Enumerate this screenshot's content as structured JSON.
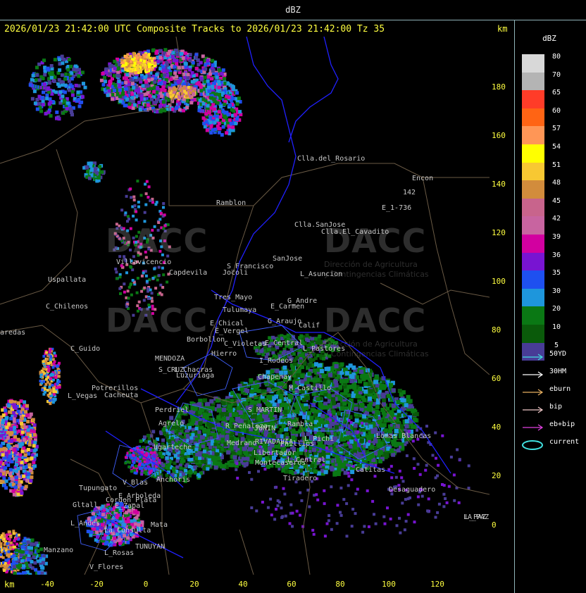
{
  "window": {
    "title": "dBZ"
  },
  "header": {
    "text": "2026/01/23 21:42:00 UTC Composite Tracks to 2026/01/23 21:42:00 Tz 35",
    "km_top": "km",
    "km_bottom": "km"
  },
  "axes": {
    "x_ticks": [
      "-40",
      "-20",
      "0",
      "20",
      "40",
      "60",
      "80",
      "100",
      "120"
    ],
    "y_ticks": [
      "180",
      "160",
      "140",
      "120",
      "100",
      "80",
      "60",
      "40",
      "20",
      "0"
    ]
  },
  "legend": {
    "title": "dBZ",
    "levels": [
      {
        "label": "80",
        "color": "#d8d8d8"
      },
      {
        "label": "70",
        "color": "#b4b4b4"
      },
      {
        "label": "65",
        "color": "#ff3c28"
      },
      {
        "label": "60",
        "color": "#ff6414"
      },
      {
        "label": "57",
        "color": "#ff9656"
      },
      {
        "label": "54",
        "color": "#ffff00"
      },
      {
        "label": "51",
        "color": "#f8c832"
      },
      {
        "label": "48",
        "color": "#d28c3c"
      },
      {
        "label": "45",
        "color": "#c8648c"
      },
      {
        "label": "42",
        "color": "#c864a0"
      },
      {
        "label": "39",
        "color": "#d200a0"
      },
      {
        "label": "36",
        "color": "#7814d2"
      },
      {
        "label": "35",
        "color": "#1e50f0"
      },
      {
        "label": "30",
        "color": "#1e96dc"
      },
      {
        "label": "20",
        "color": "#0a7814"
      },
      {
        "label": "10",
        "color": "#0a5a0a"
      },
      {
        "label": "5",
        "color": "#483c96"
      }
    ],
    "tracks": [
      {
        "label": "50YD",
        "color": "#40e0e0"
      },
      {
        "label": "30HM",
        "color": "#ffffff"
      },
      {
        "label": "eburn",
        "color": "#e8b060"
      },
      {
        "label": "bip",
        "color": "#f0c8c8"
      },
      {
        "label": "eb+bip",
        "color": "#e040e0"
      },
      {
        "label": "current",
        "color": "#40e0e0"
      }
    ]
  },
  "watermarks": [
    {
      "name": "DACC",
      "line1": "Dirección de Agricultura",
      "line2": "y Contingencias Climáticas"
    }
  ],
  "places": [
    "Clla.del_Rosario",
    "Encon",
    "142",
    "E_1-736",
    "Ramblon",
    "Clla.SanJose",
    "Clla.El_Cavadito",
    "Villavicencio",
    "Capdevila",
    "S_Francisco",
    "SanJose",
    "L_Asuncion",
    "Uspallata",
    "Jocoli",
    "C_Chilenos",
    "Tres_Mayo",
    "Tulumaya",
    "E_Carmen",
    "G_Andre",
    "aredas",
    "E_Chical",
    "E_Vergel",
    "G_Araujo",
    "Calif",
    "Borbollon",
    "C_Violetas",
    "E_Central",
    "L_Pastores",
    "C_Guido",
    "Hierro",
    "MENDOZA",
    "I_Rodeos",
    "L_Chacras",
    "Chapenay",
    "S_CRUZ",
    "Luzuriaga",
    "M_Castillo",
    "Potrerillos",
    "Cacheuta",
    "L_Vegas",
    "Perdriel",
    "S_MARTIN",
    "Rambla",
    "Agrelo",
    "R_Peñaloza",
    "JUNIN",
    "Ugarteche",
    "Medrano",
    "RIVADAVIA",
    "Phillips",
    "L_Pichi",
    "Lomas_Blancas",
    "Anchoris",
    "Tupungato",
    "Libertador",
    "Montecaseros",
    "Catitas",
    "Tiradero",
    "L_Central",
    "LA_PAZ",
    "Cordon_Plata",
    "E_Arboleda",
    "E_Zapal",
    "Gltall",
    "L_Andes",
    "La_Consulta",
    "Mata",
    "TUNUYAN",
    "Manzano",
    "L_Rosas",
    "V_Flores",
    "Desaguadero",
    "V_Blas",
    "L_PAZ"
  ]
}
